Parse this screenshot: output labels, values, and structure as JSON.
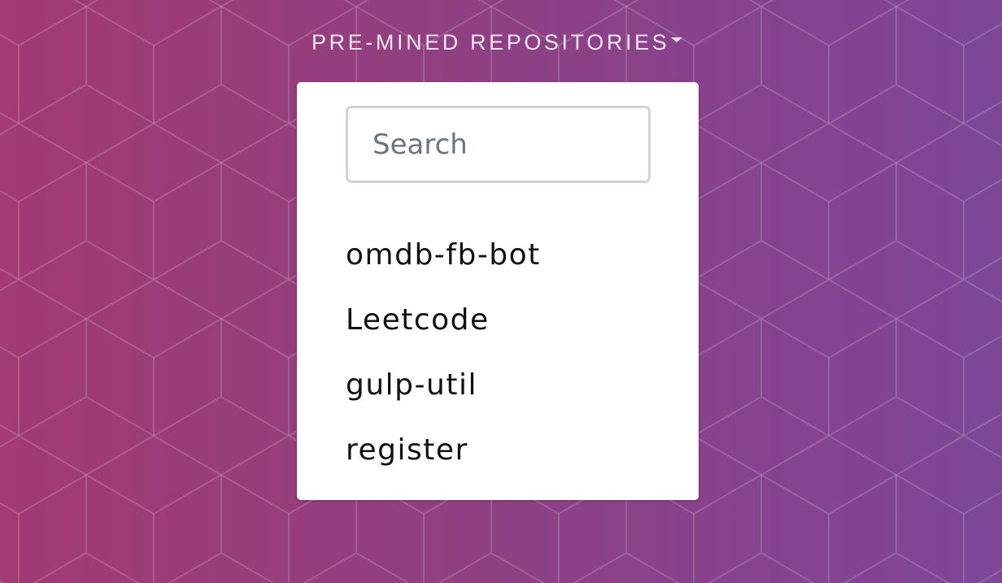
{
  "nav": {
    "label": "PRE-MINED REPOSITORIES",
    "caret_icon": "caret-down-icon"
  },
  "dropdown": {
    "search": {
      "placeholder": "Search",
      "value": ""
    },
    "repositories": [
      {
        "label": "omdb-fb-bot"
      },
      {
        "label": "Leetcode"
      },
      {
        "label": "gulp-util"
      },
      {
        "label": "register"
      }
    ]
  },
  "colors": {
    "background_start": "#a23a73",
    "background_end": "#7d4697",
    "nav_text": "#f1e6f1",
    "panel": "#ffffff",
    "item_text": "#111111"
  }
}
